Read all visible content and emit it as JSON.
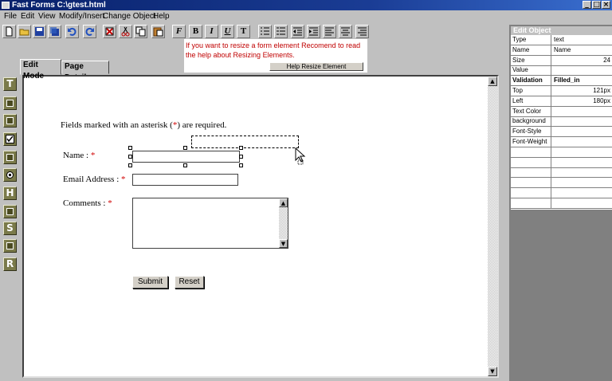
{
  "window": {
    "title": "Fast Forms C:\\gtest.html",
    "min_glyph": "_",
    "max_glyph": "□",
    "close_glyph": "×"
  },
  "menu": [
    "File",
    "Edit",
    "View",
    "Modify/Insert",
    "Change Object",
    "Help"
  ],
  "toolbar": {
    "format_labels": [
      "F",
      "B",
      "I",
      "U",
      "T"
    ],
    "icons": [
      "new-file-icon",
      "open-folder-icon",
      "save-icon",
      "save-all-icon",
      "undo-icon",
      "redo-icon",
      "delete-icon",
      "cut-icon",
      "copy-icon",
      "paste-icon",
      "bullet-list-icon",
      "numbered-list-icon",
      "outdent-icon",
      "indent-icon",
      "align-left-icon",
      "align-center-icon",
      "align-right-icon"
    ]
  },
  "hint": {
    "message": "If you want to resize a form element Recomend to read the help about Resizing Elements.",
    "help_button": "Help Resize Element"
  },
  "tabs": {
    "edit_mode": "Edit Mode",
    "page_details": "Page Details"
  },
  "palette": [
    "T",
    "",
    "",
    "",
    "",
    "",
    "H",
    "",
    "S",
    "",
    "R"
  ],
  "form": {
    "intro_before": "Fields marked with an asterisk (",
    "intro_star": "*",
    "intro_after": ") are required.",
    "name_label": "Name :",
    "email_label": "Email Address :",
    "comments_label": "Comments :",
    "required_mark": "*",
    "submit": "Submit",
    "reset": "Reset",
    "scroll_up": "▲",
    "scroll_down": "▼"
  },
  "canvas_scroll": {
    "up": "▲",
    "down": "▼"
  },
  "edit_object": {
    "heading": "Edit Object",
    "rows": [
      {
        "key": "Type",
        "value": "text"
      },
      {
        "key": "Name",
        "value": "Name"
      },
      {
        "key": "Size",
        "value": "24"
      },
      {
        "key": "Value",
        "value": ""
      },
      {
        "key": "Validation",
        "value": "Filled_in"
      },
      {
        "key": "Top",
        "value": "121px"
      },
      {
        "key": "Left",
        "value": "180px"
      },
      {
        "key": "Text Color",
        "value": ""
      },
      {
        "key": "background",
        "value": ""
      },
      {
        "key": "Font-Style",
        "value": ""
      },
      {
        "key": "Font-Weight",
        "value": ""
      },
      {
        "key": "",
        "value": ""
      },
      {
        "key": "",
        "value": ""
      },
      {
        "key": "",
        "value": ""
      },
      {
        "key": "",
        "value": ""
      },
      {
        "key": "",
        "value": ""
      },
      {
        "key": "",
        "value": ""
      }
    ]
  },
  "colors": {
    "titlebar": "#08216b",
    "hint_text": "#c00000",
    "required": "#d00000",
    "palette": "#7a7a4a"
  }
}
